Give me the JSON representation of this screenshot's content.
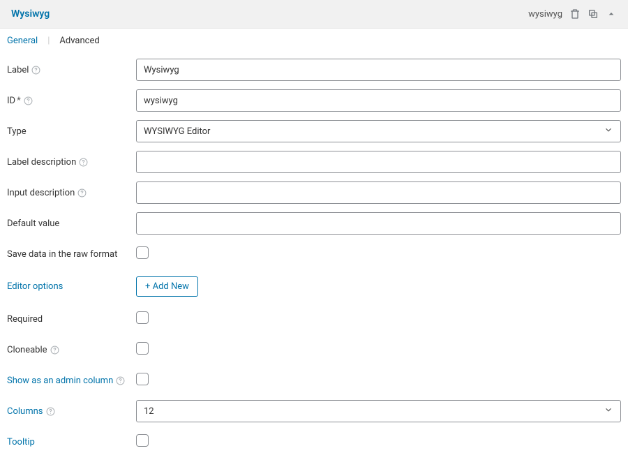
{
  "header": {
    "title": "Wysiwyg",
    "slug": "wysiwyg"
  },
  "tabs": {
    "general": "General",
    "advanced": "Advanced"
  },
  "labels": {
    "label": "Label",
    "id": "ID",
    "id_req": "*",
    "type": "Type",
    "label_description": "Label description",
    "input_description": "Input description",
    "default_value": "Default value",
    "save_raw": "Save data in the raw format",
    "editor_options": "Editor options",
    "required": "Required",
    "cloneable": "Cloneable",
    "admin_column": "Show as an admin column",
    "columns": "Columns",
    "tooltip": "Tooltip"
  },
  "values": {
    "label": "Wysiwyg",
    "id": "wysiwyg",
    "type": "WYSIWYG Editor",
    "label_description": "",
    "input_description": "",
    "default_value": "",
    "columns": "12"
  },
  "buttons": {
    "add_new": "+ Add New"
  }
}
